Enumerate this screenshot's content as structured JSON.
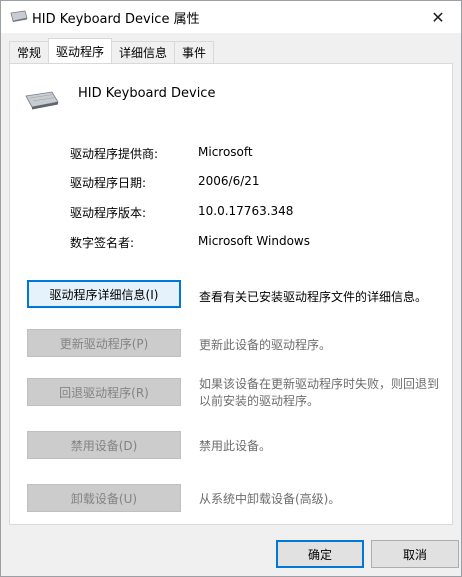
{
  "window": {
    "title": "HID Keyboard Device 属性",
    "close_glyph": "✕"
  },
  "tabs": [
    {
      "label": "常规"
    },
    {
      "label": "驱动程序"
    },
    {
      "label": "详细信息"
    },
    {
      "label": "事件"
    }
  ],
  "device": {
    "name": "HID Keyboard Device"
  },
  "properties": [
    {
      "label": "驱动程序提供商:",
      "value": "Microsoft"
    },
    {
      "label": "驱动程序日期:",
      "value": "2006/6/21"
    },
    {
      "label": "驱动程序版本:",
      "value": "10.0.17763.348"
    },
    {
      "label": "数字签名者:",
      "value": "Microsoft Windows"
    }
  ],
  "actions": [
    {
      "button": "驱动程序详细信息(I)",
      "description": "查看有关已安装驱动程序文件的详细信息。"
    },
    {
      "button": "更新驱动程序(P)",
      "description": "更新此设备的驱动程序。"
    },
    {
      "button": "回退驱动程序(R)",
      "description": "如果该设备在更新驱动程序时失败，则回退到以前安装的驱动程序。"
    },
    {
      "button": "禁用设备(D)",
      "description": "禁用此设备。"
    },
    {
      "button": "卸载设备(U)",
      "description": "从系统中卸载设备(高级)。"
    }
  ],
  "footer": {
    "ok_label": "确定",
    "cancel_label": "取消"
  },
  "colors": {
    "focus_blue": "#0078d7",
    "disabled_text": "#838383"
  }
}
